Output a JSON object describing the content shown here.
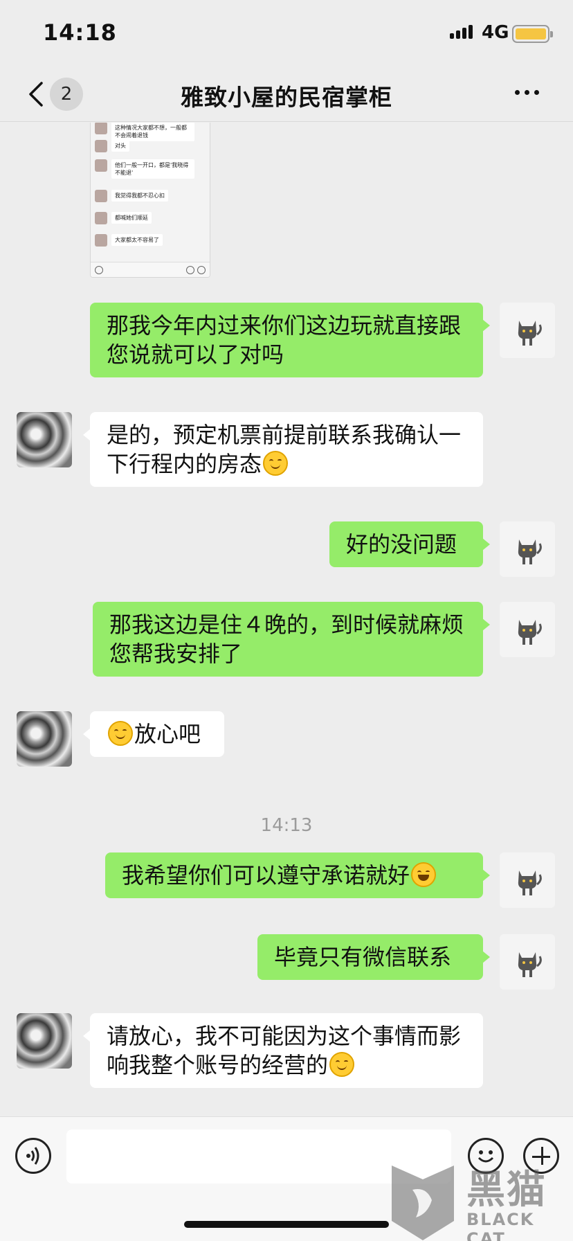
{
  "status_bar": {
    "time": "14:18",
    "network": "4G"
  },
  "header": {
    "unread_count": "2",
    "title": "雅致小屋的民宿掌柜"
  },
  "shared_screenshot": {
    "messages": [
      "这种情况大家都不想，一般都不会闹着退钱",
      "对头",
      "他们一般一开口，都是'我晓得不能退'",
      "我觉得我都不忍心扣",
      "都喊她们顺延",
      "大家都太不容易了"
    ]
  },
  "messages": [
    {
      "from": "me",
      "text": "那我今年内过来你们这边玩就直接跟您说就可以了对吗"
    },
    {
      "from": "other",
      "text": "是的，预定机票前提前联系我确认一下行程内的房态",
      "emoji": "smile"
    },
    {
      "from": "me",
      "text": "好的没问题"
    },
    {
      "from": "me",
      "text": "那我这边是住４晚的，到时候就麻烦您帮我安排了"
    },
    {
      "from": "other",
      "text": "放心吧",
      "emoji_before": "smile"
    },
    {
      "from": "me",
      "text": "我希望你们可以遵守承诺就好",
      "emoji": "laugh"
    },
    {
      "from": "me",
      "text": "毕竟只有微信联系"
    },
    {
      "from": "other",
      "text": "请放心，我不可能因为这个事情而影响我整个账号的经营的",
      "emoji": "smile"
    }
  ],
  "timestamp": "14:13",
  "watermark": {
    "cn": "黑猫",
    "en": "BLACK CAT"
  },
  "colors": {
    "sent_bubble": "#95ec69",
    "received_bubble": "#ffffff",
    "background": "#ededed"
  }
}
